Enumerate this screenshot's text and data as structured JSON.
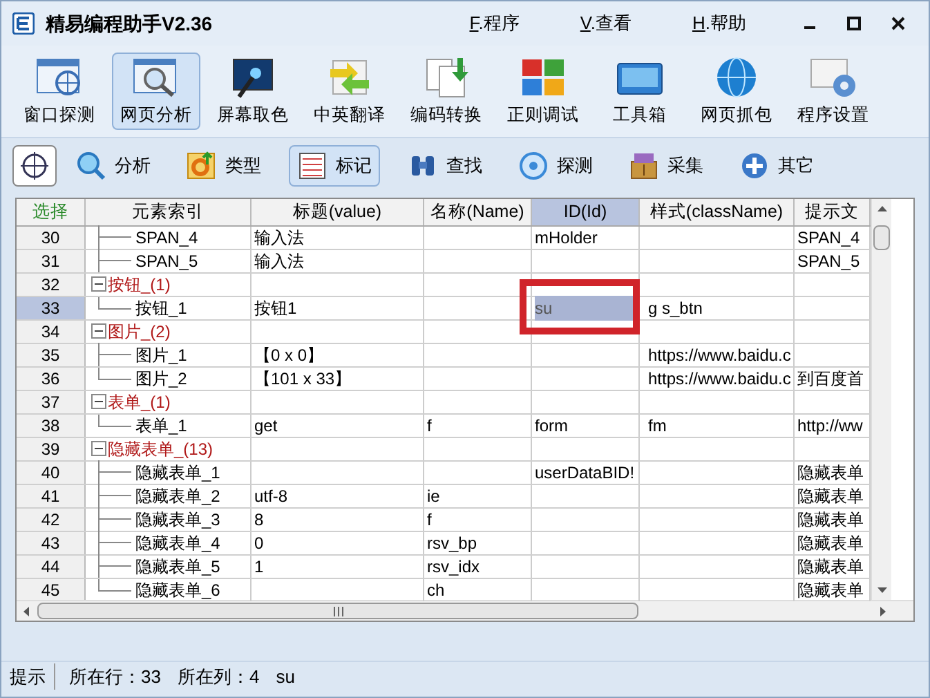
{
  "window": {
    "title": "精易编程助手V2.36",
    "menu": [
      "F.程序",
      "V.查看",
      "H.帮助"
    ]
  },
  "toolbar": [
    {
      "label": "窗口探测",
      "kind": "window",
      "selected": false
    },
    {
      "label": "网页分析",
      "kind": "web",
      "selected": true
    },
    {
      "label": "屏幕取色",
      "kind": "screen",
      "selected": false
    },
    {
      "label": "中英翻译",
      "kind": "translate",
      "selected": false
    },
    {
      "label": "编码转换",
      "kind": "encode",
      "selected": false
    },
    {
      "label": "正则调试",
      "kind": "regex",
      "selected": false
    },
    {
      "label": "工具箱",
      "kind": "tools",
      "selected": false
    },
    {
      "label": "网页抓包",
      "kind": "globe",
      "selected": false
    },
    {
      "label": "程序设置",
      "kind": "settings",
      "selected": false
    }
  ],
  "subtoolbar": [
    {
      "kind": "crosshair"
    },
    {
      "label": "分析",
      "kind": "analyze",
      "selected": false
    },
    {
      "label": "类型",
      "kind": "type",
      "selected": false
    },
    {
      "label": "标记",
      "kind": "mark",
      "selected": true
    },
    {
      "label": "查找",
      "kind": "find",
      "selected": false
    },
    {
      "label": "探测",
      "kind": "probe",
      "selected": false
    },
    {
      "label": "采集",
      "kind": "collect",
      "selected": false
    },
    {
      "label": "其它",
      "kind": "other",
      "selected": false
    }
  ],
  "table": {
    "columns": [
      {
        "label": "选择",
        "selected": false
      },
      {
        "label": "元素索引",
        "selected": false
      },
      {
        "label": "标题(value)",
        "selected": false
      },
      {
        "label": "名称(Name)",
        "selected": false
      },
      {
        "label": "ID(Id)",
        "selected": true
      },
      {
        "label": "样式(className)",
        "selected": false
      },
      {
        "label": "提示文",
        "selected": false
      }
    ],
    "marked_cell_framed": true,
    "rows": [
      {
        "index": "30",
        "label": "SPAN_4",
        "kind": "item",
        "selected": false,
        "cells": [
          "输入法",
          null,
          "mHolder",
          null,
          "SPAN_4"
        ]
      },
      {
        "index": "31",
        "label": "SPAN_5",
        "kind": "item",
        "selected": false,
        "cells": [
          "输入法",
          null,
          null,
          null,
          "SPAN_5"
        ]
      },
      {
        "index": "32",
        "label": "按钮_(1)",
        "kind": "group",
        "selected": false,
        "children": [
          {
            "index": "33",
            "label": "按钮_1",
            "kind": "item",
            "selected": true,
            "cells": [
              "按钮1",
              null,
              "su",
              "g s_btn",
              null
            ]
          }
        ]
      },
      {
        "index": "34",
        "label": "图片_(2)",
        "kind": "group",
        "selected": false,
        "children": [
          {
            "index": "35",
            "label": "图片_1",
            "kind": "item",
            "selected": false,
            "cells": [
              "【0 x 0】",
              null,
              null,
              "https://www.baidu.c",
              null
            ]
          },
          {
            "index": "36",
            "label": "图片_2",
            "kind": "item",
            "selected": false,
            "cells": [
              "【101 x 33】",
              null,
              null,
              "https://www.baidu.c",
              "到百度首"
            ]
          }
        ]
      },
      {
        "index": "37",
        "label": "表单_(1)",
        "kind": "group",
        "selected": false,
        "children": [
          {
            "index": "38",
            "label": "表单_1",
            "kind": "item",
            "selected": false,
            "cells": [
              "get",
              "f",
              "form",
              "fm",
              "http://ww"
            ]
          }
        ]
      },
      {
        "index": "39",
        "label": "隐藏表单_(13)",
        "kind": "group",
        "selected": false,
        "children": [
          {
            "index": "40",
            "label": "隐藏表单_1",
            "kind": "item",
            "selected": false,
            "cells": [
              null,
              null,
              "userDataBID!",
              null,
              "隐藏表单"
            ]
          },
          {
            "index": "41",
            "label": "隐藏表单_2",
            "kind": "item",
            "selected": false,
            "cells": [
              "utf-8",
              "ie",
              null,
              null,
              "隐藏表单"
            ]
          },
          {
            "index": "42",
            "label": "隐藏表单_3",
            "kind": "item",
            "selected": false,
            "cells": [
              "8",
              "f",
              null,
              null,
              "隐藏表单"
            ]
          },
          {
            "index": "43",
            "label": "隐藏表单_4",
            "kind": "item",
            "selected": false,
            "cells": [
              "0",
              "rsv_bp",
              null,
              null,
              "隐藏表单"
            ]
          },
          {
            "index": "44",
            "label": "隐藏表单_5",
            "kind": "item",
            "selected": false,
            "cells": [
              "1",
              "rsv_idx",
              null,
              null,
              "隐藏表单"
            ]
          },
          {
            "index": "45",
            "label": "隐藏表单_6",
            "kind": "item",
            "selected": false,
            "cells": [
              null,
              "ch",
              null,
              null,
              "隐藏表单"
            ]
          }
        ]
      }
    ]
  },
  "status_bar": {
    "label": "提示",
    "row": "所在行：33",
    "column": "所在列：4",
    "value": "su"
  }
}
